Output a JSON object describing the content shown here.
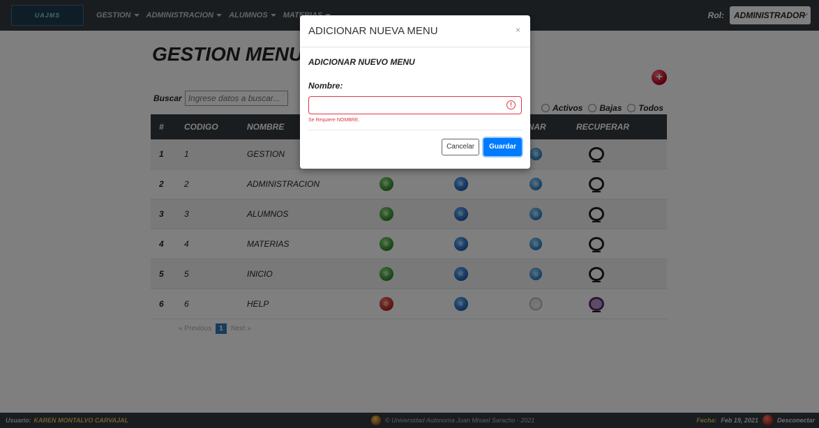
{
  "navbar": {
    "logo_text": "UAJMS",
    "menus": [
      {
        "label": "GESTION"
      },
      {
        "label": "ADMINISTRACION"
      },
      {
        "label": "ALUMNOS"
      },
      {
        "label": "MATERIAS"
      }
    ],
    "rol_label": "Rol:",
    "rol_value": "ADMINISTRADOR"
  },
  "page": {
    "title": "GESTION MENUS",
    "search_label": "Buscar",
    "search_placeholder": "Ingrese datos a buscar...",
    "filters": [
      {
        "label": "Activos"
      },
      {
        "label": "Bajas"
      },
      {
        "label": "Todos"
      }
    ]
  },
  "table": {
    "headers": {
      "num": "#",
      "code": "CODIGO",
      "name": "NOMBRE",
      "eliminar_partial": "INAR",
      "recover": "RECUPERAR"
    },
    "rows": [
      {
        "num": "1",
        "code": "1",
        "name": "GESTION",
        "state": "active"
      },
      {
        "num": "2",
        "code": "2",
        "name": "ADMINISTRACION",
        "state": "active"
      },
      {
        "num": "3",
        "code": "3",
        "name": "ALUMNOS",
        "state": "active"
      },
      {
        "num": "4",
        "code": "4",
        "name": "MATERIAS",
        "state": "active"
      },
      {
        "num": "5",
        "code": "5",
        "name": "INICIO",
        "state": "active"
      },
      {
        "num": "6",
        "code": "6",
        "name": "HELP",
        "state": "inactive"
      }
    ]
  },
  "pagination": {
    "previous": "« Previous",
    "current": "1",
    "next": "Next »"
  },
  "footer": {
    "user_label": "Usuario:",
    "user_name": "KAREN MONTALVO CARVAJAL",
    "copyright": "© Universidad Autonoma Juan Misael Saracho - 2021",
    "date_label": "Fecha:",
    "date": "Feb 19, 2021",
    "logout": "Desconectar"
  },
  "modal": {
    "title": "ADICIONAR NUEVA MENU",
    "close": "×",
    "subtitle": "ADICIONAR NUEVO MENU",
    "field_label": "Nombre:",
    "field_value": "",
    "field_error": "Se Requiere NOMBRE.",
    "cancel_label": "Cancelar",
    "save_label": "Guardar"
  },
  "colors": {
    "navbar": "#343a40",
    "primary": "#007bff",
    "danger": "#dc3545"
  }
}
